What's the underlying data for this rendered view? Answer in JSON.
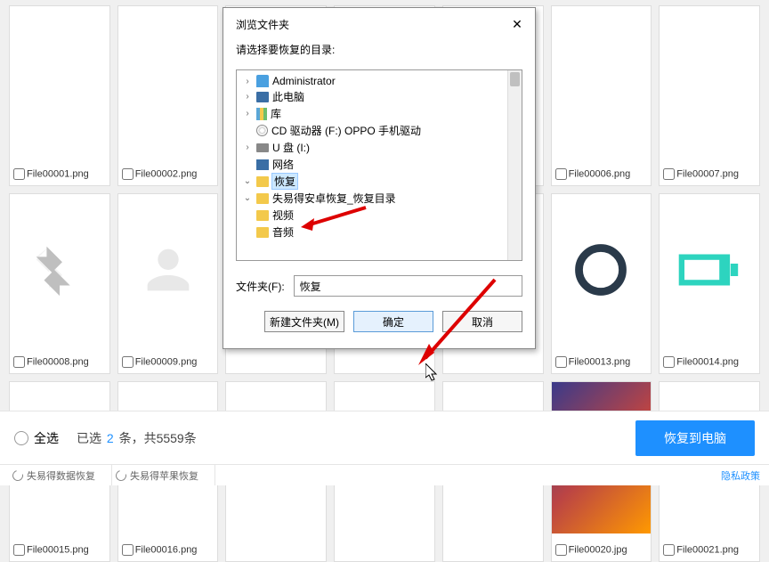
{
  "files": [
    {
      "name": "File00001.png"
    },
    {
      "name": "File00002.png"
    },
    {
      "name": ""
    },
    {
      "name": ""
    },
    {
      "name": ""
    },
    {
      "name": "File00006.png"
    },
    {
      "name": "File00007.png"
    },
    {
      "name": "File00008.png"
    },
    {
      "name": "File00009.png"
    },
    {
      "name": ""
    },
    {
      "name": ""
    },
    {
      "name": ""
    },
    {
      "name": "File00013.png"
    },
    {
      "name": "File00014.png"
    },
    {
      "name": "File00015.png"
    },
    {
      "name": "File00016.png"
    },
    {
      "name": ""
    },
    {
      "name": ""
    },
    {
      "name": ""
    },
    {
      "name": "File00020.jpg"
    },
    {
      "name": "File00021.png"
    }
  ],
  "dialog": {
    "title": "浏览文件夹",
    "subtitle": "请选择要恢复的目录:",
    "tree": {
      "admin": "Administrator",
      "pc": "此电脑",
      "lib": "库",
      "cd": "CD 驱动器 (F:) OPPO 手机驱动",
      "usb": "U 盘 (I:)",
      "net": "网络",
      "recover": "恢复",
      "subdir": "失易得安卓恢复_恢复目录",
      "video": "视频",
      "audio": "音频"
    },
    "folderLabel": "文件夹(F):",
    "folderValue": "恢复",
    "newFolder": "新建文件夹(M)",
    "ok": "确定",
    "cancel": "取消"
  },
  "bottom": {
    "selectAll": "全选",
    "prefix": "已选 ",
    "selCount": "2",
    "mid": " 条，共",
    "total": "5559",
    "suffix": "条",
    "recover": "恢复到电脑"
  },
  "footer": {
    "item1": "失易得数据恢复",
    "item2": "失易得苹果恢复",
    "privacy": "隐私政策"
  }
}
